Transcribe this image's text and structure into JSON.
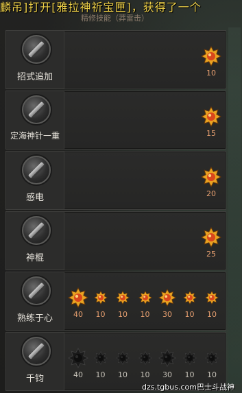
{
  "ticker": "麟吊]打开[雅拉神祈宝匣]，获得了一个",
  "subtitle": "精修技能（莽雷击）",
  "skills": [
    {
      "name": "招式追加",
      "gems": [
        {
          "level": "10",
          "type": "large-gold"
        }
      ]
    },
    {
      "name": "定海神针一重",
      "gems": [
        {
          "level": "15",
          "type": "large-gold"
        }
      ]
    },
    {
      "name": "感电",
      "gems": [
        {
          "level": "20",
          "type": "large-gold"
        }
      ]
    },
    {
      "name": "神棍",
      "gems": [
        {
          "level": "25",
          "type": "large-gold"
        }
      ]
    },
    {
      "name": "熟练于心",
      "gems": [
        {
          "level": "40",
          "type": "large-gold"
        },
        {
          "level": "10",
          "type": "small-gold"
        },
        {
          "level": "10",
          "type": "small-gold"
        },
        {
          "level": "10",
          "type": "small-gold"
        },
        {
          "level": "30",
          "type": "medium-gold"
        },
        {
          "level": "10",
          "type": "small-gold"
        },
        {
          "level": "10",
          "type": "small-gold"
        }
      ]
    },
    {
      "name": "千钧",
      "gems": [
        {
          "level": "40",
          "type": "large-dark"
        },
        {
          "level": "10",
          "type": "small-dark"
        },
        {
          "level": "10",
          "type": "small-dark"
        },
        {
          "level": "10",
          "type": "small-dark"
        },
        {
          "level": "30",
          "type": "medium-dark"
        },
        {
          "level": "10",
          "type": "small-dark"
        },
        {
          "level": "10",
          "type": "small-dark"
        }
      ]
    }
  ],
  "watermark": "dzs.tgbus.com巴士斗战神",
  "colors": {
    "ticker": "#f0d24a",
    "level_gold": "#e8a070",
    "level_dark": "#c6c2b8"
  }
}
